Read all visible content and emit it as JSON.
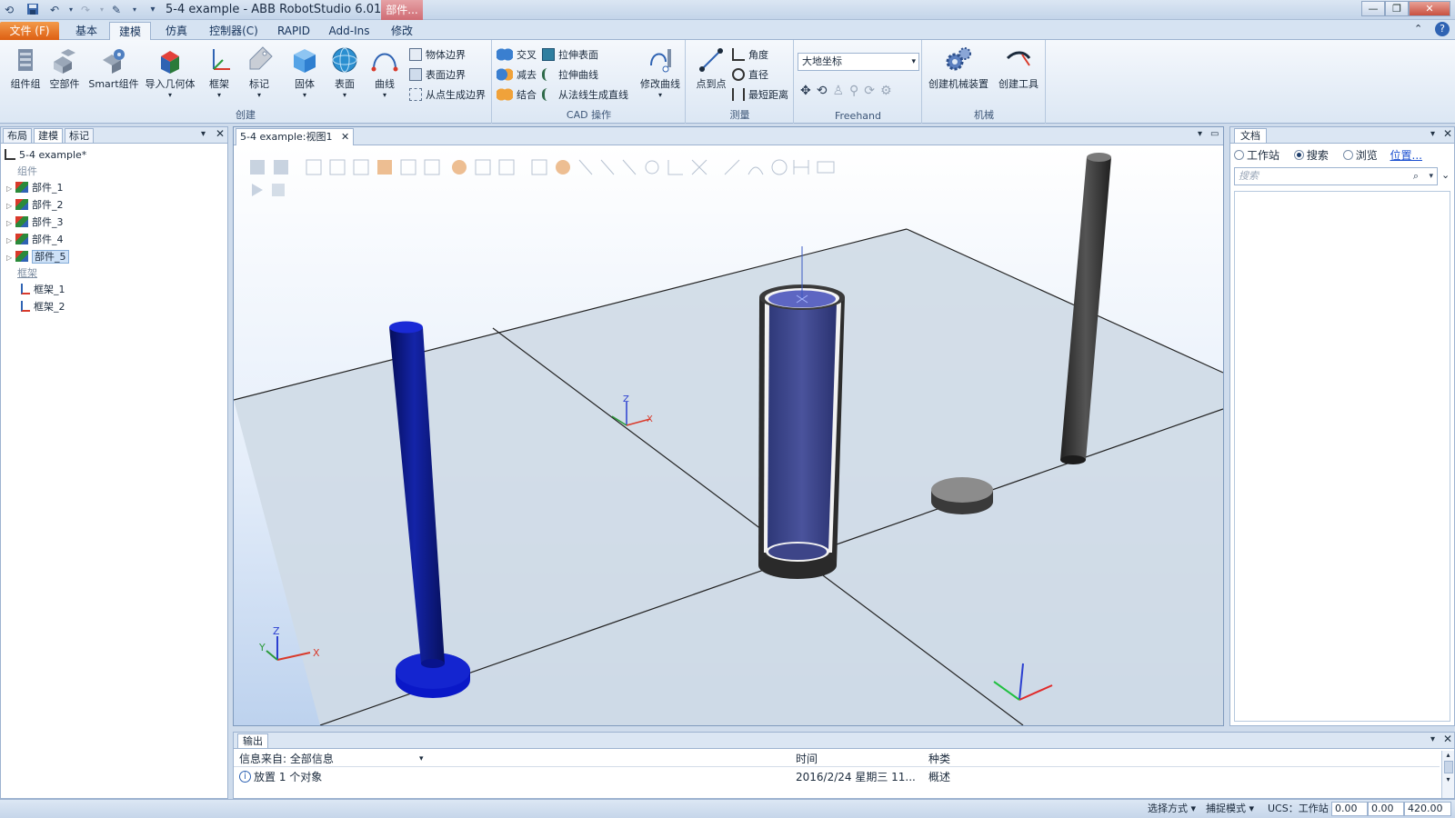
{
  "window": {
    "title": "5-4 example - ABB RobotStudio 6.01.01",
    "context_tab": "部件...",
    "controls": [
      "—",
      "❐",
      "✕"
    ]
  },
  "ribbon": {
    "file_tab": "文件 (F)",
    "tabs": [
      "基本",
      "建模",
      "仿真",
      "控制器(C)",
      "RAPID",
      "Add-Ins",
      "修改"
    ],
    "active_tab": "建模",
    "groups": {
      "create": {
        "label": "创建",
        "big_buttons": [
          "组件组",
          "空部件",
          "Smart组件",
          "导入几何体",
          "框架",
          "标记",
          "固体",
          "表面",
          "曲线"
        ],
        "small_buttons": [
          "物体边界",
          "表面边界",
          "从点生成边界"
        ]
      },
      "cad": {
        "label": "CAD 操作",
        "small_buttons": [
          "交叉",
          "减去",
          "结合",
          "拉伸表面",
          "拉伸曲线",
          "从法线生成直线"
        ],
        "big_buttons": [
          "修改曲线"
        ]
      },
      "measure": {
        "label": "测量",
        "big_buttons": [
          "点到点"
        ],
        "small_buttons": [
          "角度",
          "直径",
          "最短距离"
        ]
      },
      "freehand": {
        "label": "Freehand",
        "coord_system": "大地坐标"
      },
      "mechanism": {
        "label": "机械",
        "big_buttons": [
          "创建机械装置",
          "创建工具"
        ]
      }
    }
  },
  "left_panel": {
    "tabs": [
      "布局",
      "建模",
      "标记"
    ],
    "active_tab": "建模",
    "station": "5-4 example*",
    "components_header": "组件",
    "parts": [
      "部件_1",
      "部件_2",
      "部件_3",
      "部件_4",
      "部件_5"
    ],
    "selected_part": "部件_5",
    "frames_header": "框架",
    "frames": [
      "框架_1",
      "框架_2"
    ]
  },
  "viewport": {
    "tab_label": "5-4 example:视图1",
    "axis_labels": {
      "x": "X",
      "y": "Y",
      "z": "Z"
    }
  },
  "right_panel": {
    "title": "文档",
    "radio_options": [
      "工作站",
      "搜索",
      "浏览"
    ],
    "selected_radio": "搜索",
    "location_link": "位置...",
    "search_placeholder": "搜索"
  },
  "output": {
    "title": "输出",
    "source_label": "信息来自: 全部信息",
    "col_time": "时间",
    "col_type": "种类",
    "message": "放置 1 个对象",
    "time": "2016/2/24 星期三 11...",
    "type": "概述"
  },
  "status_bar": {
    "select_mode": "选择方式 ▾",
    "snap_mode": "捕捉模式 ▾",
    "ucs": "UCS：工作站",
    "coords": [
      "0.00",
      "0.00",
      "420.00"
    ]
  },
  "colors": {
    "accent_blue": "#1d3d6b",
    "file_tab_orange": "#e26e1f",
    "cylinder_blue": "#0b1a8f",
    "grey_post": "#3c3c3c"
  }
}
